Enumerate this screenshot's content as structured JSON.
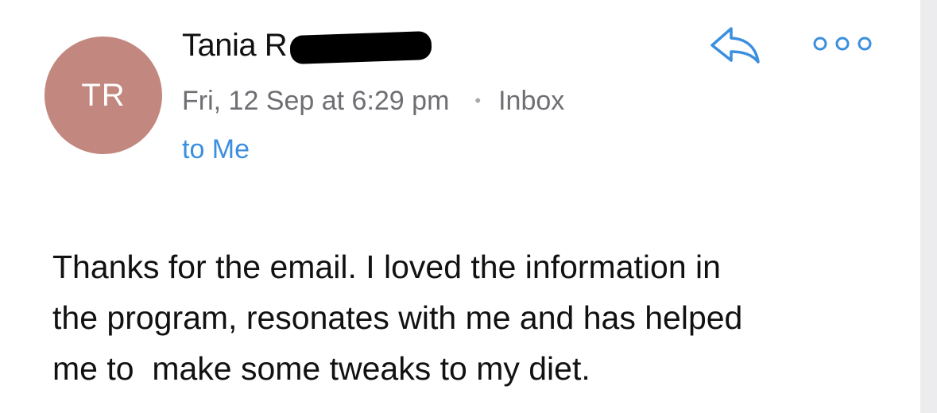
{
  "email": {
    "avatar_initials": "TR",
    "avatar_color": "#c2877f",
    "sender_name": "Tania R",
    "date": "Fri, 12 Sep at 6:29 pm",
    "separator": "•",
    "folder": "Inbox",
    "recipient": "to Me",
    "body": "Thanks for the email. I loved the information in\nthe program, resonates with me and has helped\nme to  make some tweaks to my diet."
  },
  "icons": {
    "reply": "reply-icon",
    "more": "more-options-icon"
  },
  "colors": {
    "link": "#3b8fde",
    "meta_text": "#6e6e73",
    "body_text": "#111111"
  }
}
